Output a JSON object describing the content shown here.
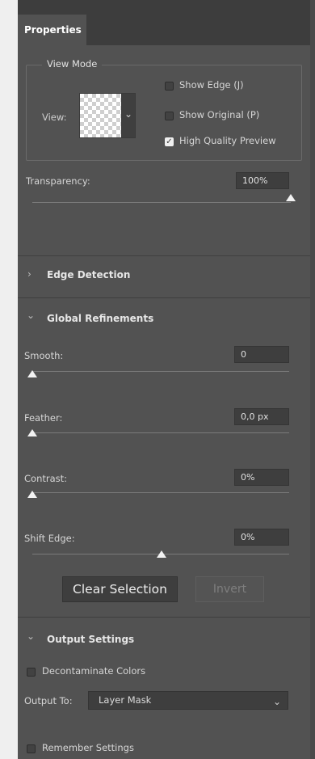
{
  "panel": {
    "tab_label": "Properties"
  },
  "view_mode": {
    "legend": "View Mode",
    "view_label": "View:",
    "options": [
      {
        "label": "Show Edge (J)",
        "checked": false
      },
      {
        "label": "Show Original (P)",
        "checked": false
      },
      {
        "label": "High Quality Preview",
        "checked": true
      }
    ]
  },
  "transparency": {
    "label": "Transparency:",
    "value": "100%",
    "slider_level": 1.0
  },
  "edge_detection": {
    "title": "Edge Detection",
    "expanded": false
  },
  "global_refinements": {
    "title": "Global Refinements",
    "expanded": true,
    "sliders": [
      {
        "label": "Smooth:",
        "value": "0",
        "slider_level": 0.0
      },
      {
        "label": "Feather:",
        "value": "0,0 px",
        "slider_level": 0.0
      },
      {
        "label": "Contrast:",
        "value": "0%",
        "slider_level": 0.0
      },
      {
        "label": "Shift Edge:",
        "value": "0%",
        "slider_level": 0.5
      }
    ],
    "clear_selection_label": "Clear Selection",
    "invert_label": "Invert"
  },
  "output_settings": {
    "title": "Output Settings",
    "decontaminate_label": "Decontaminate Colors",
    "output_to_label": "Output To:",
    "output_to_value": "Layer Mask",
    "remember_label": "Remember Settings"
  },
  "colors": {
    "panel_bg": "#525252",
    "field_bg": "#3e3e3e",
    "text": "#d6d6d6"
  }
}
